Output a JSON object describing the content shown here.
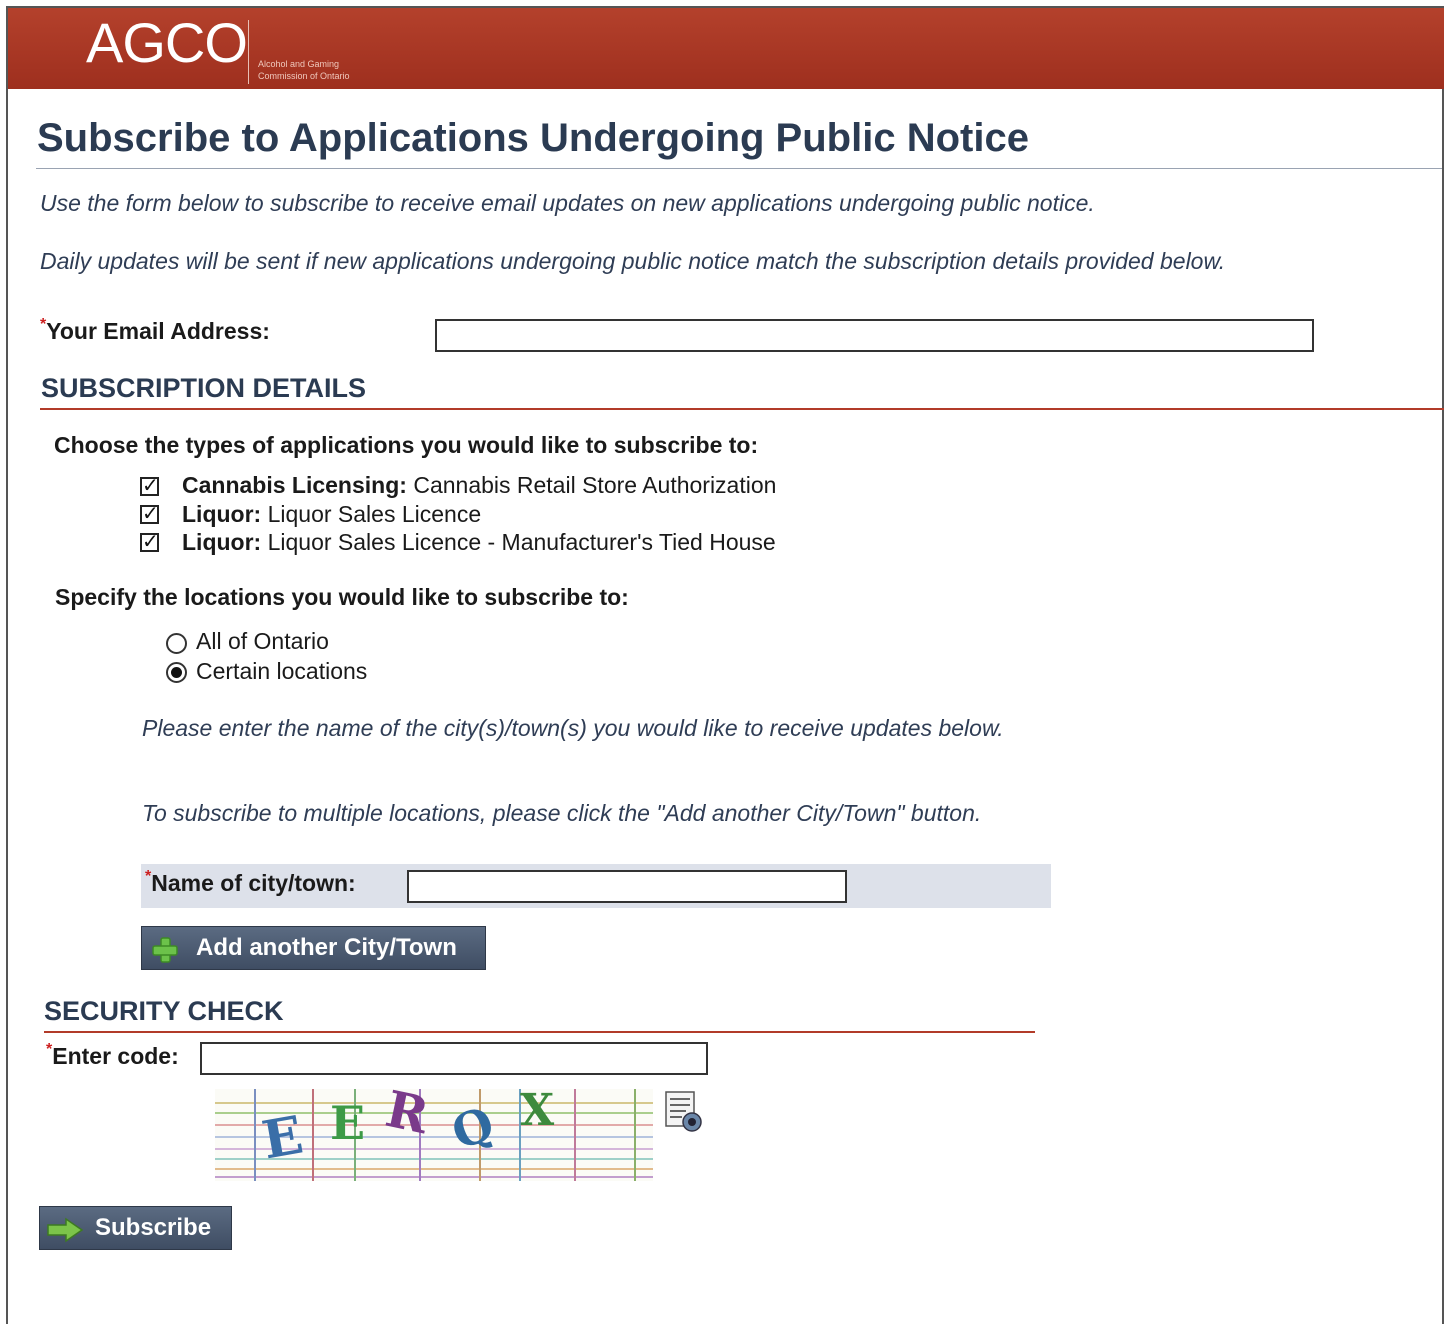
{
  "header": {
    "logo": "AGCO",
    "logo_subtitle_line1": "Alcohol and Gaming",
    "logo_subtitle_line2": "Commission of Ontario"
  },
  "page": {
    "title": "Subscribe to Applications Undergoing Public Notice",
    "intro_1": "Use the form below to subscribe to receive email updates on new applications undergoing public notice.",
    "intro_2": "Daily updates will be sent if new applications undergoing public notice match the subscription details provided below."
  },
  "email": {
    "required_mark": "*",
    "label": "Your Email Address:",
    "value": ""
  },
  "subscription": {
    "heading": "SUBSCRIPTION DETAILS",
    "types_prompt": "Choose the types of applications you would like to subscribe to:",
    "types": [
      {
        "category": "Cannabis Licensing:",
        "detail": "Cannabis Retail Store Authorization",
        "checked": true
      },
      {
        "category": "Liquor:",
        "detail": "Liquor Sales Licence",
        "checked": true
      },
      {
        "category": "Liquor:",
        "detail": "Liquor Sales Licence - Manufacturer's Tied House",
        "checked": true
      }
    ],
    "locations_prompt": "Specify the locations you would like to subscribe to:",
    "location_options": [
      {
        "label": "All of Ontario",
        "selected": false
      },
      {
        "label": "Certain locations",
        "selected": true
      }
    ],
    "hint_1": "Please enter the name of the city(s)/town(s) you would like to receive updates below.",
    "hint_2": "To subscribe to multiple locations, please click the \"Add another City/Town\" button.",
    "city_label": "Name of city/town:",
    "city_value": "",
    "add_city_button": "Add another City/Town"
  },
  "security": {
    "heading": "SECURITY CHECK",
    "code_label": "Enter code:",
    "code_value": "",
    "captcha_letters": [
      "E",
      "E",
      "R",
      "Q",
      "X"
    ]
  },
  "subscribe_button": "Subscribe",
  "colors": {
    "header_red": "#a9372a",
    "heading_navy": "#2b3b52",
    "rule_red": "#b23b29",
    "button_slate": "#4b5a70"
  }
}
